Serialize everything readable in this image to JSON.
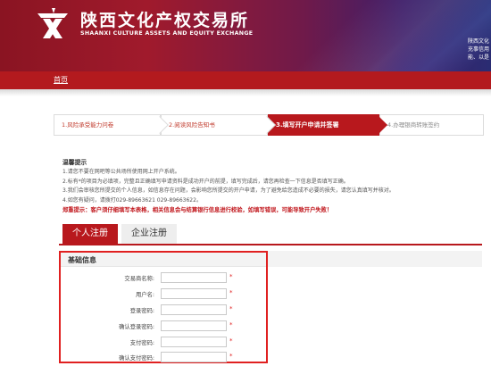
{
  "header": {
    "title": "陕西文化产权交易所",
    "subtitle": "SHAANXI CULTURE ASSETS AND EQUITY EXCHANGE",
    "corner_lines": [
      "陕西文化",
      "充事信用",
      "能、以是"
    ]
  },
  "nav": {
    "home": "首页"
  },
  "steps": [
    {
      "label": "1.风险承受能力问卷"
    },
    {
      "label": "2.阅读风险告知书"
    },
    {
      "label": "3.填写开户申请并签署"
    },
    {
      "label": "4.办理银商转账签约"
    }
  ],
  "tips": {
    "title": "温馨提示",
    "lines": [
      "1.请您不要在网吧等公共场所使用网上开户系统。",
      "2.标有*的项目为必填项，完整且正确填写申请资料是成功开户的前提，填写完成后，请您再检查一下信息是否填写正确。",
      "3.我们会审核您所提交的个人信息，如信息存在问题，会影响您所提交的开户申请，为了避免给您造成不必要的损失，请您认真填写并核对。",
      "4.如您有疑问，请拨打029-89663621 029-89663622。"
    ],
    "warning": "郑重提示：客户须仔细填写本表格，相关信息会与结算银行信息进行校验，如填写错误，可能导致开户失败！"
  },
  "tabs": {
    "personal": "个人注册",
    "company": "企业注册"
  },
  "form": {
    "title": "基础信息",
    "fields": [
      {
        "label": "交易商名称:",
        "value": "",
        "required": "*"
      },
      {
        "label": "用户名:",
        "value": "",
        "required": "*"
      },
      {
        "label": "登录密码:",
        "value": "",
        "required": "*"
      },
      {
        "label": "确认登录密码:",
        "value": "",
        "required": "*"
      },
      {
        "label": "支付密码:",
        "value": "",
        "required": "*"
      },
      {
        "label": "确认支付密码:",
        "value": "",
        "required": "*"
      }
    ]
  },
  "colors": {
    "brand_red": "#b8181d",
    "highlight_border": "#e02020",
    "warning_text": "#c0141a"
  }
}
